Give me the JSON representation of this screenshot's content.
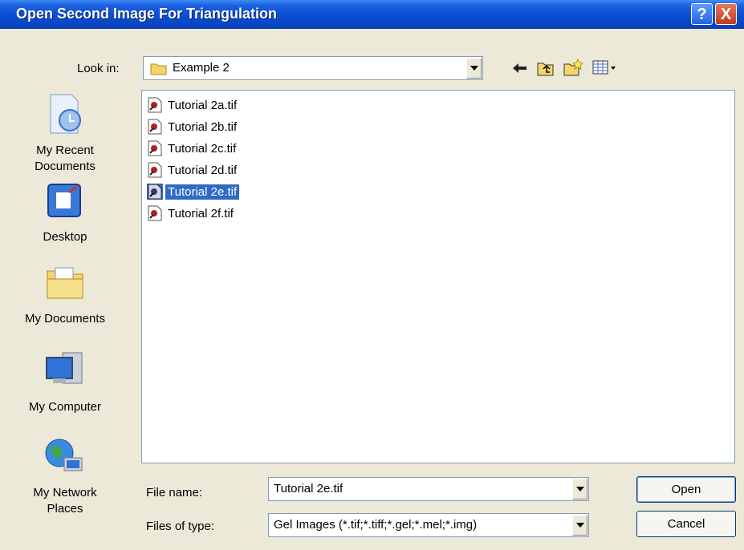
{
  "window": {
    "title": "Open Second Image For Triangulation"
  },
  "titlebar": {
    "help_glyph": "?",
    "close_glyph": "X"
  },
  "lookin": {
    "label": "Look in:",
    "value": "Example 2",
    "icon": "folder-icon"
  },
  "toolbar": {
    "icons": [
      "back-arrow-icon",
      "up-folder-icon",
      "new-folder-icon",
      "view-menu-icon"
    ]
  },
  "places": [
    {
      "label": "My Recent Documents",
      "icon": "recent-documents-icon"
    },
    {
      "label": "Desktop",
      "icon": "desktop-icon"
    },
    {
      "label": "My Documents",
      "icon": "my-documents-icon"
    },
    {
      "label": "My Computer",
      "icon": "my-computer-icon"
    },
    {
      "label": "My Network Places",
      "icon": "network-places-icon"
    }
  ],
  "files": [
    {
      "name": "Tutorial 2a.tif",
      "selected": false
    },
    {
      "name": "Tutorial 2b.tif",
      "selected": false
    },
    {
      "name": "Tutorial 2c.tif",
      "selected": false
    },
    {
      "name": "Tutorial 2d.tif",
      "selected": false
    },
    {
      "name": "Tutorial 2e.tif",
      "selected": true
    },
    {
      "name": "Tutorial 2f.tif",
      "selected": false
    }
  ],
  "filename": {
    "label": "File name:",
    "value": "Tutorial 2e.tif"
  },
  "filetype": {
    "label": "Files of type:",
    "value": "Gel Images (*.tif;*.tiff;*.gel;*.mel;*.img)"
  },
  "buttons": {
    "open": "Open",
    "cancel": "Cancel"
  },
  "colors": {
    "titlebar": "#0a4fd6",
    "selection": "#316ac5",
    "dialog_bg": "#ece9d8"
  }
}
